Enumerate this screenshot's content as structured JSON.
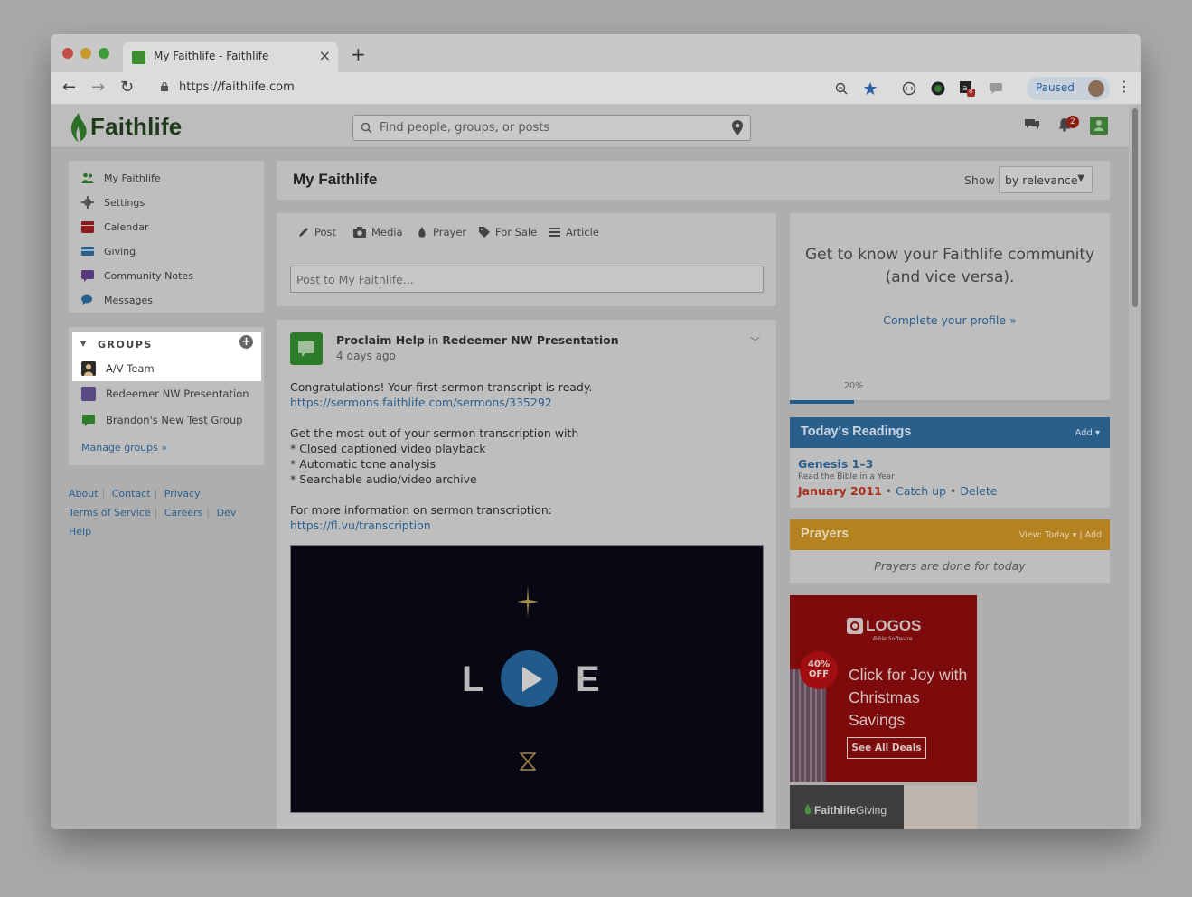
{
  "browser": {
    "tab_title": "My Faithlife - Faithlife",
    "tab_close": "×",
    "new_tab": "+",
    "url": "https://faithlife.com",
    "paused_label": "Paused",
    "ext_badge": "8"
  },
  "site": {
    "logo_text": "Faithlife",
    "search_placeholder": "Find people, groups, or posts",
    "notification_count": "2"
  },
  "sidebar": {
    "items": [
      {
        "label": "My Faithlife",
        "icon": "people-icon"
      },
      {
        "label": "Settings",
        "icon": "gear-icon"
      },
      {
        "label": "Calendar",
        "icon": "calendar-icon"
      },
      {
        "label": "Giving",
        "icon": "card-icon"
      },
      {
        "label": "Community Notes",
        "icon": "note-icon"
      },
      {
        "label": "Messages",
        "icon": "chat-icon"
      }
    ],
    "groups_heading": "GROUPS",
    "groups": [
      {
        "label": "A/V Team"
      },
      {
        "label": "Redeemer NW Presentation"
      },
      {
        "label": "Brandon's New Test Group"
      }
    ],
    "manage_groups": "Manage groups »"
  },
  "footer": {
    "about": "About",
    "contact": "Contact",
    "privacy": "Privacy",
    "terms": "Terms of Service",
    "careers": "Careers",
    "dev": "Dev",
    "help": "Help"
  },
  "feed": {
    "title": "My Faithlife",
    "show_label": "Show",
    "show_value": "by relevance"
  },
  "composer": {
    "tabs": {
      "post": "Post",
      "media": "Media",
      "prayer": "Prayer",
      "for_sale": "For Sale",
      "article": "Article"
    },
    "placeholder": "Post to My Faithlife..."
  },
  "post": {
    "author": "Proclaim Help",
    "in_word": "in",
    "group": "Redeemer NW Presentation",
    "time": "4 days ago",
    "lines": {
      "l1": "Congratulations! Your first sermon transcript is ready.",
      "l2": "https://sermons.faithlife.com/sermons/335292",
      "l3": "Get the most out of your sermon transcription with",
      "l4": "* Closed captioned video playback",
      "l5": "* Automatic tone analysis",
      "l6": "* Searchable audio/video archive",
      "l7": "For more information on sermon transcription:",
      "l8": "https://fl.vu/transcription"
    },
    "video_left": "L",
    "video_right": "E"
  },
  "profile": {
    "line1": "Get to know your Faithlife community",
    "line2": "(and vice versa).",
    "link": "Complete your profile »",
    "progress_label": "20%",
    "progress": 0.2
  },
  "readings": {
    "title": "Today's Readings",
    "add": "Add ▾",
    "passage": "Genesis 1–3",
    "plan": "Read the Bible in a Year",
    "date": "January 2011",
    "catch_up": "Catch up",
    "delete": "Delete",
    "dot": "•"
  },
  "prayers": {
    "title": "Prayers",
    "view": "View: Today ▾ | Add",
    "empty": "Prayers are done for today"
  },
  "ad": {
    "logo": "LOGOS",
    "logo_sub": "Bible Software",
    "badge_pct": "40%",
    "badge_off": "OFF",
    "headline": "Click for Joy with Christmas Savings",
    "button": "See All Deals"
  },
  "giving_ad": {
    "brand": "Faithlife",
    "word": "Giving"
  },
  "colors": {
    "brand_green": "#2d7c2a",
    "link_blue": "#2b5f8e",
    "readings_blue": "#2a5f8b",
    "prayers_gold": "#b58220",
    "ad_red": "#7e0b0c"
  }
}
